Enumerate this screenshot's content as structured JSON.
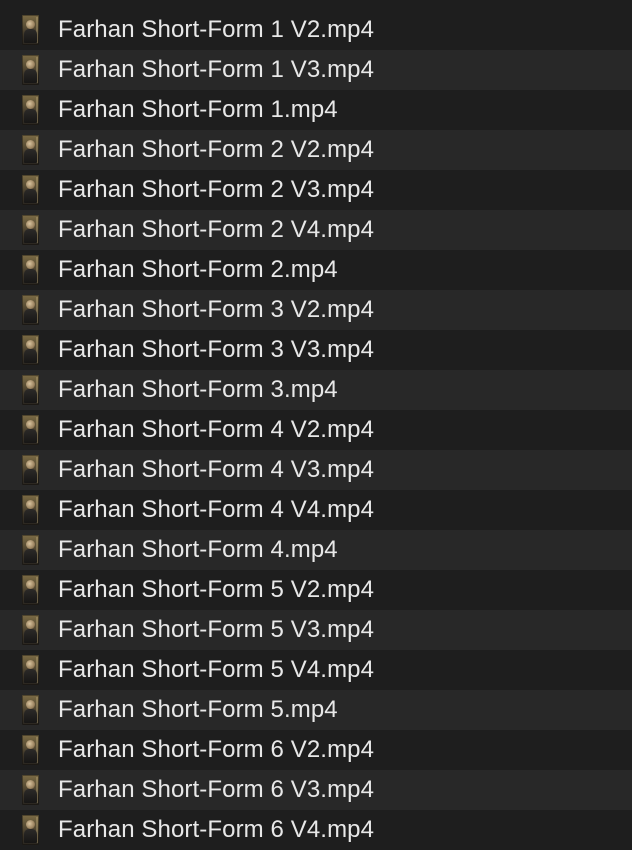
{
  "files": [
    {
      "name": "Farhan Short-Form 1 V2.mp4",
      "icon": "video-thumbnail-icon"
    },
    {
      "name": "Farhan Short-Form 1 V3.mp4",
      "icon": "video-thumbnail-icon"
    },
    {
      "name": "Farhan Short-Form 1.mp4",
      "icon": "video-thumbnail-icon"
    },
    {
      "name": "Farhan Short-Form 2 V2.mp4",
      "icon": "video-thumbnail-icon"
    },
    {
      "name": "Farhan Short-Form 2 V3.mp4",
      "icon": "video-thumbnail-icon"
    },
    {
      "name": "Farhan Short-Form 2 V4.mp4",
      "icon": "video-thumbnail-icon"
    },
    {
      "name": "Farhan Short-Form 2.mp4",
      "icon": "video-thumbnail-icon"
    },
    {
      "name": "Farhan Short-Form 3 V2.mp4",
      "icon": "video-thumbnail-icon"
    },
    {
      "name": "Farhan Short-Form 3 V3.mp4",
      "icon": "video-thumbnail-icon"
    },
    {
      "name": "Farhan Short-Form 3.mp4",
      "icon": "video-thumbnail-icon"
    },
    {
      "name": "Farhan Short-Form 4 V2.mp4",
      "icon": "video-thumbnail-icon"
    },
    {
      "name": "Farhan Short-Form 4 V3.mp4",
      "icon": "video-thumbnail-icon"
    },
    {
      "name": "Farhan Short-Form 4 V4.mp4",
      "icon": "video-thumbnail-icon"
    },
    {
      "name": "Farhan Short-Form 4.mp4",
      "icon": "video-thumbnail-icon"
    },
    {
      "name": "Farhan Short-Form 5 V2.mp4",
      "icon": "video-thumbnail-icon"
    },
    {
      "name": "Farhan Short-Form 5 V3.mp4",
      "icon": "video-thumbnail-icon"
    },
    {
      "name": "Farhan Short-Form 5 V4.mp4",
      "icon": "video-thumbnail-icon"
    },
    {
      "name": "Farhan Short-Form 5.mp4",
      "icon": "video-thumbnail-icon"
    },
    {
      "name": "Farhan Short-Form 6 V2.mp4",
      "icon": "video-thumbnail-icon"
    },
    {
      "name": "Farhan Short-Form 6 V3.mp4",
      "icon": "video-thumbnail-icon"
    },
    {
      "name": "Farhan Short-Form 6 V4.mp4",
      "icon": "video-thumbnail-icon"
    }
  ],
  "colors": {
    "background": "#1e1e1e",
    "row_alt": "#282828",
    "text": "#e8e8e8"
  }
}
